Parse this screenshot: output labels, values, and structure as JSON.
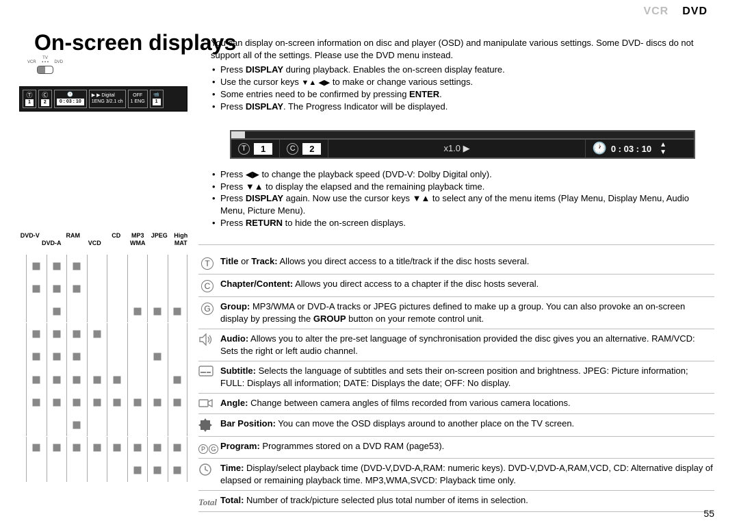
{
  "tabs": {
    "vcr": "VCR",
    "dvd": "DVD"
  },
  "title": "On-screen displays",
  "intro": {
    "p1": "You can display on-screen information on disc and player (OSD) and manipulate various settings. Some DVD- discs do not support all of the settings. Please use the DVD menu instead.",
    "b1a": "Press ",
    "b1b": "DISPLAY",
    "b1c": " during playback. Enables the on-screen display feature.",
    "b2a": "Use the cursor keys ",
    "b2b": " to make or change various settings.",
    "b3a": "Some entries need to be confirmed by pressing ",
    "b3b": "ENTER",
    "b3c": ".",
    "b4a": "Press ",
    "b4b": "DISPLAY",
    "b4c": ". The Progress Indicator will be displayed."
  },
  "osd_big": {
    "title_num": "1",
    "chapter_num": "2",
    "speed": "x1.0 ▶",
    "time": "0 : 03 : 10"
  },
  "intro2": {
    "b1": "Press ◀▶ to change the playback speed (DVD-V: Dolby Digital only).",
    "b2": "Press ▼▲ to display the elapsed and the remaining playback time.",
    "b3a": "Press ",
    "b3b": "DISPLAY",
    "b3c": " again. Now use the cursor keys ▼▲ to select any of the menu items (Play Menu, Display Menu, Audio Menu, Picture Menu).",
    "b4a": "Press ",
    "b4b": "RETURN",
    "b4c": " to hide the on-screen displays."
  },
  "osd_mini": {
    "title": "1",
    "chapter": "2",
    "time": "0 : 03 : 10",
    "audio_line1": "▶ ▶ Digital",
    "audio_line2": "1ENG 3/2.1 ch",
    "subtitle_line1": "OFF",
    "subtitle_line2": "1 ENG",
    "angle": "1"
  },
  "tv_mini": {
    "top": "TV",
    "left": "VCR",
    "right": "DVD"
  },
  "formats": {
    "row1": [
      "DVD-V",
      "",
      "RAM",
      "",
      "CD",
      "MP3",
      "JPEG",
      "High"
    ],
    "row2": [
      "",
      "DVD-A",
      "",
      "VCD",
      "",
      "WMA",
      "",
      "MAT"
    ]
  },
  "grid": {
    "rows": [
      [
        1,
        1,
        1,
        0,
        0,
        0,
        0,
        0
      ],
      [
        1,
        1,
        1,
        0,
        0,
        0,
        0,
        0
      ],
      [
        0,
        1,
        0,
        0,
        0,
        1,
        1,
        1
      ],
      [
        1,
        1,
        1,
        1,
        0,
        0,
        0,
        0
      ],
      [
        1,
        1,
        1,
        0,
        0,
        0,
        1,
        0
      ],
      [
        1,
        1,
        1,
        1,
        1,
        0,
        0,
        1
      ],
      [
        1,
        1,
        1,
        1,
        1,
        1,
        1,
        1
      ],
      [
        0,
        0,
        1,
        0,
        0,
        0,
        0,
        0
      ],
      [
        1,
        1,
        1,
        1,
        1,
        1,
        1,
        1
      ],
      [
        0,
        0,
        0,
        0,
        0,
        1,
        1,
        1
      ]
    ]
  },
  "desc": [
    {
      "icon": "T",
      "label": "Title",
      "text": " or ",
      "label2": "Track:",
      "rest": " Allows you direct access to a title/track if the disc hosts several."
    },
    {
      "icon": "C",
      "label": "Chapter/Content:",
      "rest": " Allows you direct access to a chapter if the disc hosts several."
    },
    {
      "icon": "G",
      "label": "Group:",
      "rest": " MP3/WMA or DVD-A tracks or JPEG pictures defined to make up a group. You can also provoke an on-screen display by pressing the ",
      "bold2": "GROUP",
      "rest2": " button on your remote control unit."
    },
    {
      "icon": "audio",
      "label": "Audio:",
      "rest": " Allows you to alter the pre-set language of synchronisation provided the disc gives you an alternative. RAM/VCD: Sets the right or left audio channel."
    },
    {
      "icon": "subtitle",
      "label": "Subtitle:",
      "rest": " Selects the language of subtitles and sets their on-screen position and brightness. JPEG: Picture information; FULL: Displays all information; DATE: Displays the date; OFF: No display."
    },
    {
      "icon": "angle",
      "label": "Angle:",
      "rest": " Change between camera angles of films recorded from various camera locations."
    },
    {
      "icon": "barpos",
      "label": "Bar Position:",
      "rest": " You can move the OSD displays around to another place on the TV screen."
    },
    {
      "icon": "PG",
      "label": "Program:",
      "rest": " Programmes stored on a DVD RAM (page53)."
    },
    {
      "icon": "time",
      "label": "Time:",
      "rest": " Display/select playback time (DVD-V,DVD-A,RAM: numeric keys). DVD-V,DVD-A,RAM,VCD, CD: Alternative display of elapsed or remaining playback time. MP3,WMA,SVCD: Playback time only."
    },
    {
      "icon": "total",
      "label": "Total:",
      "rest": " Number of track/picture selected plus total number of items in selection."
    }
  ],
  "page_number": "55"
}
